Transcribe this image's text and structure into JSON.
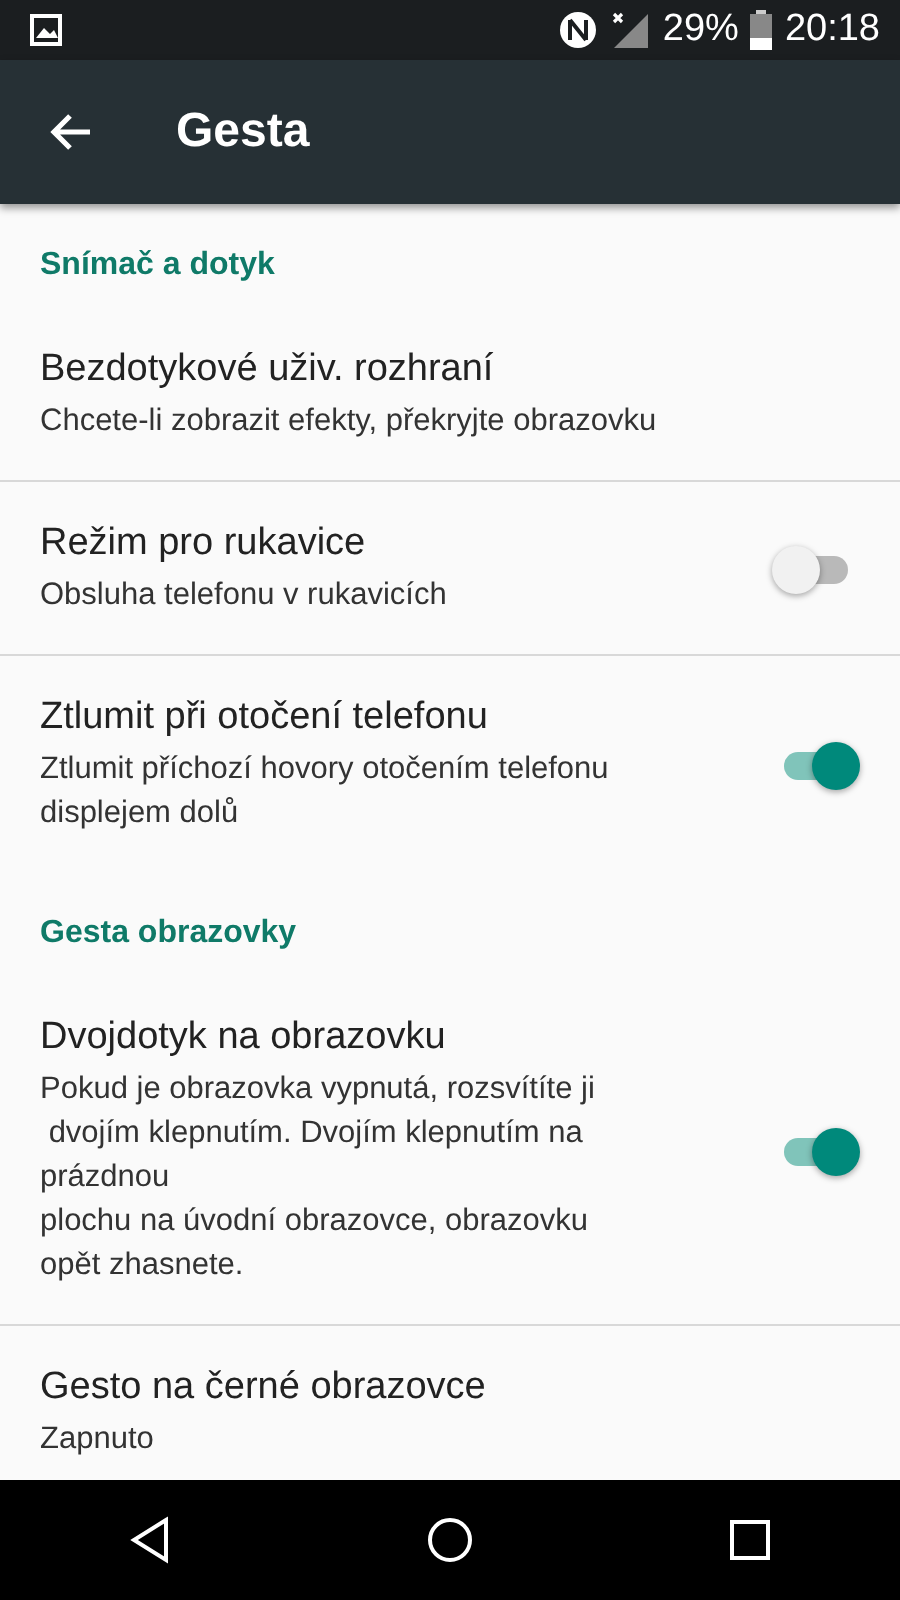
{
  "status_bar": {
    "battery": "29%",
    "time": "20:18"
  },
  "toolbar": {
    "title": "Gesta"
  },
  "rows": [
    {
      "kind": "section",
      "title": "Snímač a dotyk"
    },
    {
      "kind": "plain",
      "title": "Bezdotykové uživ. rozhraní",
      "summary": "Chcete-li zobrazit efekty, překryjte obrazovku",
      "divider": true
    },
    {
      "kind": "switch",
      "title": "Režim pro rukavice",
      "summary": "Obsluha telefonu v rukavicích",
      "on": false,
      "divider": true
    },
    {
      "kind": "switch",
      "title": "Ztlumit při otočení telefonu",
      "summary": "Ztlumit příchozí hovory otočením telefonu\ndisplejem dolů",
      "on": true,
      "divider": false
    },
    {
      "kind": "section",
      "title": "Gesta obrazovky"
    },
    {
      "kind": "switch",
      "title": "Dvojdotyk na obrazovku",
      "summary": "Pokud je obrazovka vypnutá, rozsvítíte ji\n dvojím klepnutím. Dvojím klepnutím na\nprázdnou\nplochu na úvodní obrazovce, obrazovku\nopět zhasnete.",
      "on": true,
      "divider": true
    },
    {
      "kind": "plain",
      "title": "Gesto na černé obrazovce",
      "summary": "Zapnuto",
      "divider": false
    }
  ]
}
